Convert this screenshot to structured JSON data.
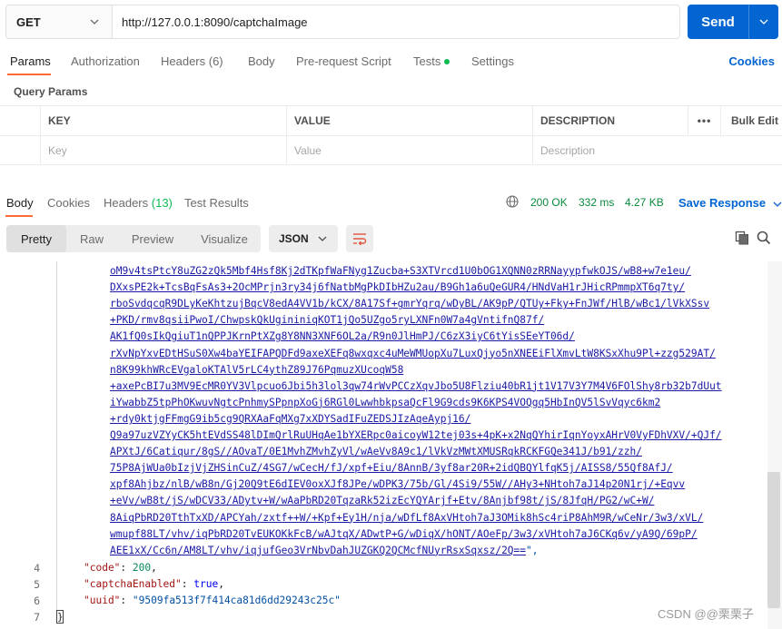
{
  "request": {
    "method": "GET",
    "url": "http://127.0.0.1:8090/captchaImage",
    "send_label": "Send"
  },
  "req_tabs": [
    {
      "label": "Params"
    },
    {
      "label": "Authorization"
    },
    {
      "label": "Headers (6)"
    },
    {
      "label": "Body"
    },
    {
      "label": "Pre-request Script"
    },
    {
      "label": "Tests"
    },
    {
      "label": "Settings"
    }
  ],
  "cookies_label": "Cookies",
  "query_params": {
    "title": "Query Params",
    "headers": [
      "KEY",
      "VALUE",
      "DESCRIPTION"
    ],
    "more": "•••",
    "bulk_edit": "Bulk Edit",
    "placeholders": {
      "key": "Key",
      "value": "Value",
      "description": "Description"
    }
  },
  "response": {
    "tabs": {
      "body": "Body",
      "cookies": "Cookies",
      "headers": "Headers",
      "headers_count": "(13)",
      "test_results": "Test Results"
    },
    "status": "200 OK",
    "time": "332 ms",
    "size": "4.27 KB",
    "save": "Save Response"
  },
  "view_modes": [
    "Pretty",
    "Raw",
    "Preview",
    "Visualize"
  ],
  "format": "JSON",
  "body_lines": [
    "oM9v4tsPtcY8uZG2zQk5Mbf4Hsf8Kj2dTKpfWaFNyg1Zucba+S3XTVrcd1U0bOG1XQNN0zRRNayypfwkOJS/wB8+w7e1eu/",
    "DXxsPE2k+TcsBqFsAs3+2OcMPrjn3ry34j6fNatbMgPkDIbHZu2au/B9Gh1a6uQeGUR4/HNdVaH1rJHicRPmmpXT6q7ty/",
    "rboSvdqcqR9DLyKeKhtzujBqcV8edA4VV1b/kCX/8A17Sf+gmrYqrq/wDyBL/AK9pP/QTUy+Fky+FnJWf/HlB/wBc1/lVkXSsv",
    "+PKD/rmv8qsiiPwoI/ChwpskQkUgininiqKOT1jQo5UZgo5ryLXNFn0W7a4gVntifnQ87f/",
    "AK1fQ0sIkQgiuT1nQPPJKrnPtXZg8Y8NN3XNF6OL2a/R9n0JlHmPJ/C6zX3iyC6tYisSEeYT06d/",
    "rXvNpYxvEDtHSuS0Xw4baYEIFAPQDFd9axeXEFq8wxqxc4uMeWMUopXu7LuxQjyo5nXNEEiFlXmvLtW8KSxXhu9Pl+zzg529AT/",
    "n8K99khWRcEVgaloKTAlV5rLC4ythZ89J76PqmuzXUcoqW58",
    "+axePcBI7u3MV9EcMR0YV3Vlpcuo6Jbi5h3lol3qw74rWvPCCzXqvJbo5U8Flziu40bR1jt1V17V3Y7M4V6FOlShy8rb32b7dUut",
    "iYwabbZ5tpPhOKwuvNgtcPnhmySPpnpXoGj6RGl0LwwhbkpsaQcFl9G9cds9K6KPS4VOQgq5HbInQV5lSvVqyc6km2",
    "+rdy0ktjgFFmgG9ib5cg9QRXAaFqMXg7xXDYSadIFuZEDSJIzAqeAypj16/",
    "Q9a97uzVZYyCK5htEVdSS48lDImQrlRuUHqAe1bYXERpc0aicoyW12tej03s+4pK+x2NqQYhirIqnYoyxAHrV0VyFDhVXV/+QJf/",
    "APXtJ/6Catiqur/8gS//AOvaT/0E1MvhZMvhZyVl/wAeVv8A9c1/lVkVzMWtXMUSRqkRCKFGQe341J/b91/zzh/",
    "75P8AjWUa0bIzjVjZHSinCuZ/4SG7/wCecH/fJ/xpf+Eiu/8AnnB/3yf8ar20R+2idQBQYlfqK5j/AISS8/55Qf8AfJ/",
    "xpf8Ahjbz/nlB/wB8n/Gj20Q9tE6dIEV0oxXJf8JPe/wDPK3/75b/Gl/4Si9/55W//AHy3+NHtoh7aJ14p20N1rj/+Eqvv",
    "+eVv/wB8t/jS/wDCV33/ADytv+W/wAaPbRD20TqzaRk52izEcYQYArjf+Etv/8Anjbf98t/jS/8JfqH/PG2/wC+W/",
    "8AiqPbRD20TthTxXD/APCYah/zxtf++W/+Kpf+Ey1H/nja/wDfLf8AxVHtoh7aJ3OMik8hSc4riP8AhM9R/wCeNr/3w3/xVL/",
    "wmupf88LT/vhv/iqPbRD20TvEUKOKkFcB/wAJtqX/ADwtP+G/wDiqX/hONT/AOeFp/3w3/xVHtoh7aJ6CKq6v/yA9Q/69pP/",
    "AEE1xX/Cc6n/AM8LT/vhv/iqjufGeo3VrNbvDahJUZGKQ2QCMcfNUyrRsxSqxsz/2Q=="
  ],
  "json_fields": [
    {
      "key": "\"code\"",
      "value": "200",
      "kind": "num"
    },
    {
      "key": "\"captchaEnabled\"",
      "value": "true",
      "kind": "bool"
    },
    {
      "key": "\"uuid\"",
      "value": "\"9509fa513f7f414ca81d6dd29243c25c\"",
      "kind": "str"
    }
  ],
  "line_numbers": [
    "4",
    "5",
    "6",
    "7"
  ],
  "watermark": "CSDN @@栗栗子"
}
